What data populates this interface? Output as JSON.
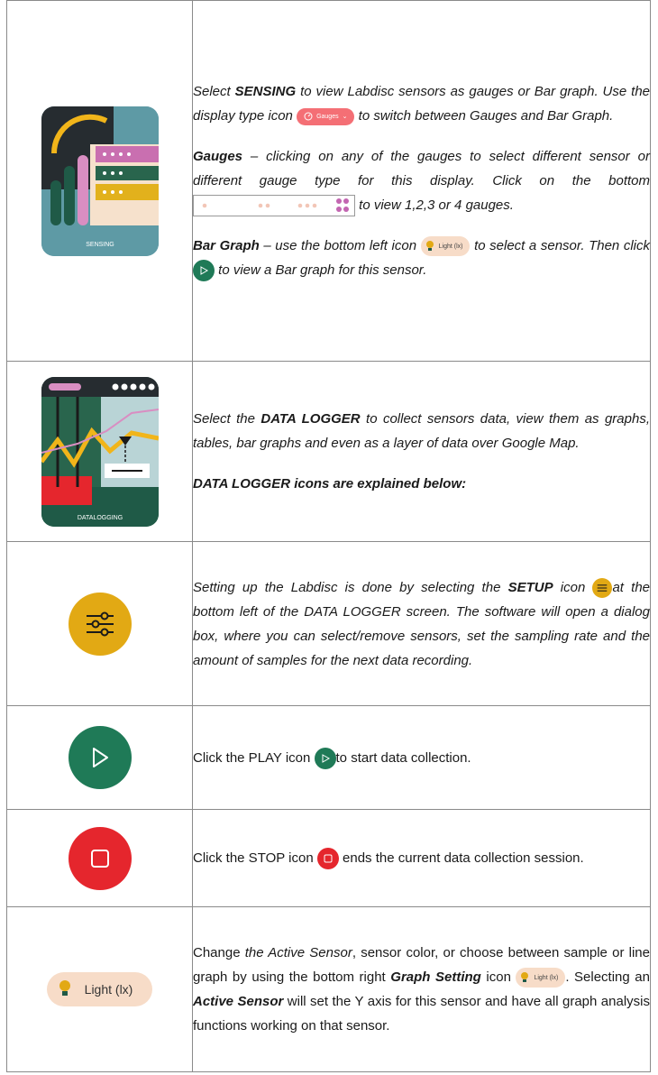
{
  "rows": {
    "sensing": {
      "tile_caption": "SENSING",
      "p1_a": "Select ",
      "p1_b": "SENSING",
      "p1_c": " to view Labdisc sensors as gauges or Bar graph. Use the display type icon ",
      "p1_d": " to switch between Gauges and Bar Graph.",
      "gauges_button_label": "Gauges",
      "p2_a": "Gauges",
      "p2_b": " – clicking on any of the gauges to select different sensor or different gauge type for this display. Click on the bottom ",
      "p2_c": " to view 1,2,3 or 4 gauges.",
      "p3_a": "Bar Graph",
      "p3_b": " – use the bottom left icon ",
      "p3_c": " to select a sensor. Then click ",
      "p3_d": " to view a Bar graph for this sensor.",
      "light_label": "Light (lx)"
    },
    "datalogger": {
      "tile_caption": "DATALOGGING",
      "p1_a": "Select the ",
      "p1_b": "DATA LOGGER",
      "p1_c": " to collect sensors data, view them as graphs, tables, bar graphs and even as a layer of data over Google Map.",
      "p2": "DATA LOGGER icons are explained below:"
    },
    "setup": {
      "a": "Setting up the Labdisc is done by selecting the ",
      "b": "SETUP",
      "c": " icon ",
      "d": "at the bottom left of the DATA LOGGER screen. The software will open a dialog box, where you can select/remove sensors, set the sampling rate and the amount of samples for the next data recording."
    },
    "play": {
      "a": "Click   the PLAY icon ",
      "b": "to start data collection."
    },
    "stop": {
      "a": "Click the STOP icon ",
      "b": " ends the current data collection session."
    },
    "graph_setting": {
      "a": "Change ",
      "b": "the Active Sensor",
      "c": ", sensor color, or choose between sample or line graph by using the bottom right ",
      "d": "Graph Setting",
      "e": " icon ",
      "f": ". Selecting an ",
      "g": "Active Sensor",
      "h": " will set the Y axis for this sensor and have all graph analysis functions working on that sensor.",
      "light_label": "Light (lx)"
    }
  },
  "colors": {
    "green": "#1f7a57",
    "red": "#e5262d",
    "yellow": "#e2a914",
    "peach": "#f7dcc8",
    "pink": "#f06c72"
  }
}
